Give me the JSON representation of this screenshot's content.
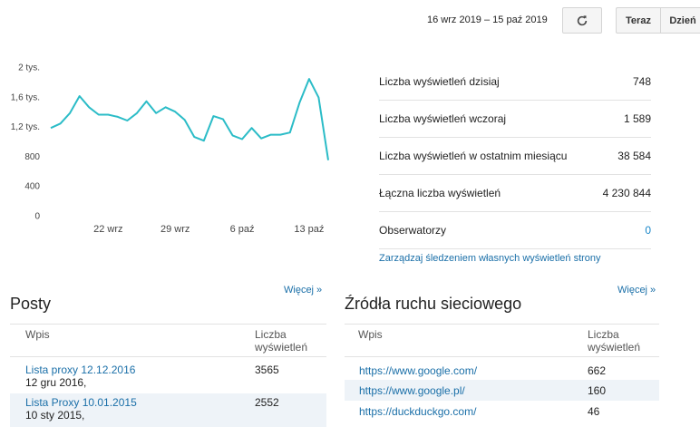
{
  "header": {
    "date_range": "16 wrz 2019 – 15 paź 2019",
    "refresh_icon": "refresh-icon",
    "btn_now": "Teraz",
    "btn_day": "Dzień"
  },
  "chart_data": {
    "type": "line",
    "color": "#2bbcc7",
    "y_ticks": [
      "2 tys.",
      "1,6 tys.",
      "1,2 tys.",
      "800",
      "400",
      "0"
    ],
    "y_tick_values": [
      2000,
      1600,
      1200,
      800,
      400,
      0
    ],
    "ylim": [
      0,
      2000
    ],
    "x_tick_labels": [
      "22 wrz",
      "29 wrz",
      "6 paź",
      "13 paź"
    ],
    "x_tick_dates": [
      "2019-09-22",
      "2019-09-29",
      "2019-10-06",
      "2019-10-13"
    ],
    "x": [
      "2019-09-16",
      "2019-09-17",
      "2019-09-18",
      "2019-09-19",
      "2019-09-20",
      "2019-09-21",
      "2019-09-22",
      "2019-09-23",
      "2019-09-24",
      "2019-09-25",
      "2019-09-26",
      "2019-09-27",
      "2019-09-28",
      "2019-09-29",
      "2019-09-30",
      "2019-10-01",
      "2019-10-02",
      "2019-10-03",
      "2019-10-04",
      "2019-10-05",
      "2019-10-06",
      "2019-10-07",
      "2019-10-08",
      "2019-10-09",
      "2019-10-10",
      "2019-10-11",
      "2019-10-12",
      "2019-10-13",
      "2019-10-14",
      "2019-10-15"
    ],
    "values": [
      1180,
      1240,
      1380,
      1610,
      1460,
      1360,
      1360,
      1330,
      1280,
      1380,
      1540,
      1380,
      1460,
      1400,
      1290,
      1060,
      1010,
      1340,
      1300,
      1080,
      1030,
      1180,
      1040,
      1090,
      1090,
      1120,
      1520,
      1840,
      1590,
      748
    ],
    "grid": false
  },
  "stats": [
    {
      "label": "Liczba wyświetleń dzisiaj",
      "value": "748",
      "link": false
    },
    {
      "label": "Liczba wyświetleń wczoraj",
      "value": "1 589",
      "link": false
    },
    {
      "label": "Liczba wyświetleń w ostatnim miesiącu",
      "value": "38 584",
      "link": false
    },
    {
      "label": "Łączna liczba wyświetleń",
      "value": "4 230 844",
      "link": false
    },
    {
      "label": "Obserwatorzy",
      "value": "0",
      "link": true
    }
  ],
  "manage_link": "Zarządzaj śledzeniem własnych wyświetleń strony",
  "posts": {
    "more": "Więcej »",
    "title": "Posty",
    "col_entry": "Wpis",
    "col_views_1": "Liczba",
    "col_views_2": "wyświetleń",
    "rows": [
      {
        "title": "Lista proxy 12.12.2016",
        "date": "12 gru 2016,",
        "views": "3565"
      },
      {
        "title": "Lista Proxy 10.01.2015",
        "date": "10 sty 2015,",
        "views": "2552"
      }
    ]
  },
  "sources": {
    "more": "Więcej »",
    "title": "Źródła ruchu sieciowego",
    "col_entry": "Wpis",
    "col_views_1": "Liczba",
    "col_views_2": "wyświetleń",
    "rows": [
      {
        "url": "https://www.google.com/",
        "views": "662"
      },
      {
        "url": "https://www.google.pl/",
        "views": "160"
      },
      {
        "url": "https://duckduckgo.com/",
        "views": "46"
      }
    ]
  }
}
